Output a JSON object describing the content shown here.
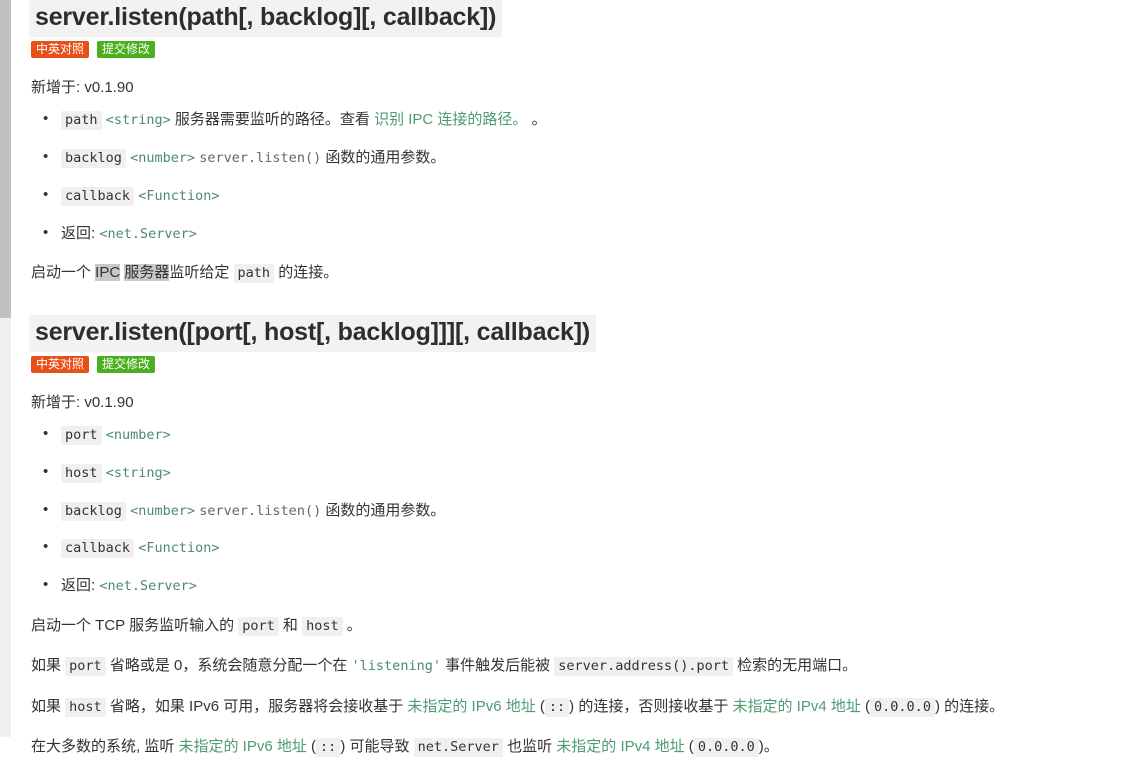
{
  "scrollbar": {
    "name": "vertical-scrollbar"
  },
  "sections": [
    {
      "id": "server-listen-path",
      "heading": "server.listen(path[, backlog][, callback])",
      "badges": {
        "bilingual": "中英对照",
        "submit_change": "提交修改"
      },
      "added_in": "新增于: v0.1.90",
      "params": [
        {
          "name": "path",
          "type": "<string>",
          "desc_pre": "服务器需要监听的路径。查看 ",
          "link": "识别 IPC 连接的路径。",
          "desc_post": " 。"
        },
        {
          "name": "backlog",
          "type": "<number>",
          "code_ref": "server.listen()",
          "desc_post": " 函数的通用参数。"
        },
        {
          "name": "callback",
          "type": "<Function>"
        },
        {
          "returns_label": "返回:",
          "type": "<net.Server>"
        }
      ],
      "body": {
        "t1": "启动一个 ",
        "hl1": "IPC",
        "t2": " ",
        "hl2": "服务器",
        "t3": "监听给定 ",
        "code1": "path",
        "t4": " 的连接。"
      }
    },
    {
      "id": "server-listen-port",
      "heading": "server.listen([port[, host[, backlog]]][, callback])",
      "badges": {
        "bilingual": "中英对照",
        "submit_change": "提交修改"
      },
      "added_in": "新增于: v0.1.90",
      "params": [
        {
          "name": "port",
          "type": "<number>"
        },
        {
          "name": "host",
          "type": "<string>"
        },
        {
          "name": "backlog",
          "type": "<number>",
          "code_ref": "server.listen()",
          "desc_post": " 函数的通用参数。"
        },
        {
          "name": "callback",
          "type": "<Function>"
        },
        {
          "returns_label": "返回:",
          "type": "<net.Server>"
        }
      ],
      "paragraphs": {
        "p1": {
          "t1": "启动一个 TCP 服务监听输入的 ",
          "code1": "port",
          "t2": " 和 ",
          "code2": "host",
          "t3": " 。"
        },
        "p2": {
          "t1": "如果 ",
          "code1": "port",
          "t2": " 省略或是 0，系统会随意分配一个在 ",
          "str1": "'listening'",
          "t3": " 事件触发后能被 ",
          "code2": "server.address().port",
          "t4": " 检索的无用端口。"
        },
        "p3": {
          "t1": "如果 ",
          "code1": "host",
          "t2": " 省略，如果 IPv6 可用，服务器将会接收基于 ",
          "link1": "未指定的 IPv6 地址",
          "t3": " (",
          "code2": "::",
          "t4": ") 的连接，否则接收基于 ",
          "link2": "未指定的 IPv4 地址",
          "t5": " (",
          "code3": "0.0.0.0",
          "t6": ") 的连接。"
        },
        "p4": {
          "t1": "在大多数的系统, 监听 ",
          "link1": "未指定的 IPv6 地址",
          "t2": " (",
          "code1": "::",
          "t3": ") 可能导致 ",
          "code2": "net.Server",
          "t4": " 也监听 ",
          "link2": "未指定的 IPv4 地址",
          "t5": " (",
          "code3": "0.0.0.0",
          "t6": ")。"
        }
      }
    }
  ],
  "colors": {
    "badge_bilingual": "#e8501a",
    "badge_submit": "#4caf20",
    "link_green": "#4f9a72",
    "code_bg": "#f0f0f0",
    "heading_bg": "#f2f2f2",
    "scrollbar_thumb": "#c1c1c1",
    "text": "#333333"
  }
}
